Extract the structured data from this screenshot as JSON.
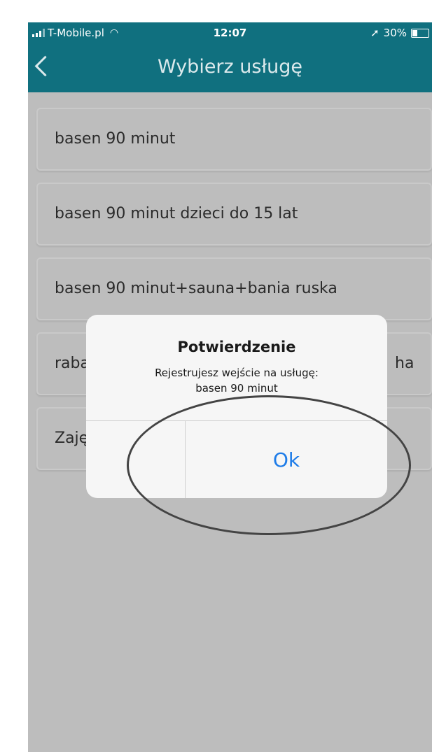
{
  "status_bar": {
    "carrier": "T-Mobile.pl",
    "time": "12:07",
    "battery": "30%",
    "icons": [
      "signal-icon",
      "wifi-icon",
      "location-arrow-icon",
      "battery-icon"
    ]
  },
  "nav": {
    "title": "Wybierz usługę",
    "back_icon": "chevron-left-icon"
  },
  "services": [
    {
      "label": "basen 90 minut"
    },
    {
      "label": "basen 90 minut dzieci do 15 lat"
    },
    {
      "label": "basen 90 minut+sauna+bania ruska"
    },
    {
      "label": "raba"
    },
    {
      "label": "Zaję"
    }
  ],
  "service_4_right_fragment": "ha",
  "dialog": {
    "title": "Potwierdzenie",
    "message_line1": "Rejestrujesz wejście na usługę:",
    "message_line2": "basen 90 minut",
    "ok_label": "Ok"
  },
  "colors": {
    "header": "#10707f",
    "overlay_background": "#bdbdbd",
    "dialog_background": "#f6f6f6",
    "ok_button": "#1e7ce8"
  }
}
